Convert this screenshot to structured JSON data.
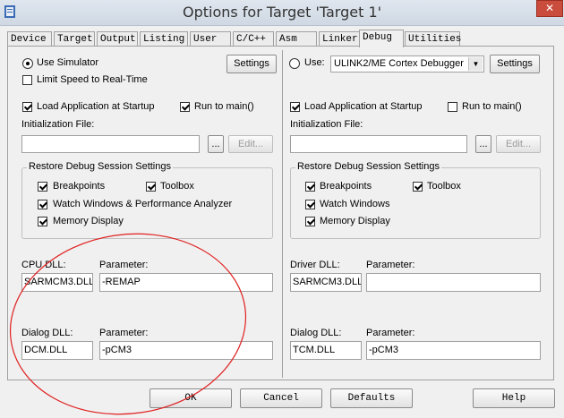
{
  "window": {
    "title": "Options for Target 'Target 1'",
    "close_glyph": "✕"
  },
  "tabs": [
    "Device",
    "Target",
    "Output",
    "Listing",
    "User",
    "C/C++",
    "Asm",
    "Linker",
    "Debug",
    "Utilities"
  ],
  "active_tab": "Debug",
  "left": {
    "use_simulator": "Use Simulator",
    "settings": "Settings",
    "limit_speed": "Limit Speed to Real-Time",
    "load_app": "Load Application at Startup",
    "run_to_main": "Run to main()",
    "init_file_label": "Initialization File:",
    "init_file_value": "",
    "browse": "...",
    "edit": "Edit...",
    "restore_group": "Restore Debug Session Settings",
    "breakpoints": "Breakpoints",
    "toolbox": "Toolbox",
    "watch": "Watch Windows & Performance Analyzer",
    "memory": "Memory Display",
    "cpu_dll_label": "CPU DLL:",
    "param_label": "Parameter:",
    "cpu_dll_value": "SARMCM3.DLL",
    "cpu_param_value": "-REMAP",
    "dialog_dll_label": "Dialog DLL:",
    "dialog_dll_value": "DCM.DLL",
    "dialog_param_value": "-pCM3"
  },
  "right": {
    "use_label": "Use:",
    "debugger": "ULINK2/ME Cortex Debugger",
    "settings": "Settings",
    "load_app": "Load Application at Startup",
    "run_to_main": "Run to main()",
    "init_file_label": "Initialization File:",
    "init_file_value": "",
    "browse": "...",
    "edit": "Edit...",
    "restore_group": "Restore Debug Session Settings",
    "breakpoints": "Breakpoints",
    "toolbox": "Toolbox",
    "watch": "Watch Windows",
    "memory": "Memory Display",
    "driver_dll_label": "Driver DLL:",
    "param_label": "Parameter:",
    "driver_dll_value": "SARMCM3.DLL",
    "driver_param_value": "",
    "dialog_dll_label": "Dialog DLL:",
    "dialog_dll_value": "TCM.DLL",
    "dialog_param_value": "-pCM3"
  },
  "buttons": {
    "ok": "OK",
    "cancel": "Cancel",
    "defaults": "Defaults",
    "help": "Help"
  },
  "annotation_color": "#e02020"
}
